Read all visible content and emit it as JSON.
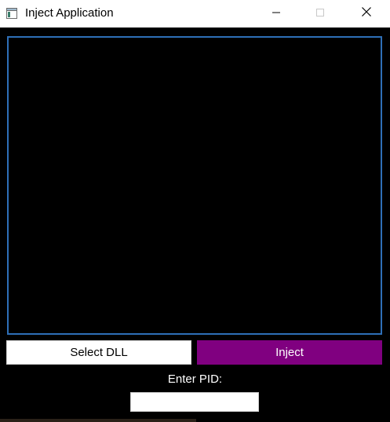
{
  "window": {
    "title": "Inject Application",
    "icon": "app-window-icon",
    "controls": {
      "minimize_icon": "minimize-icon",
      "maximize_icon": "maximize-icon",
      "close_icon": "close-icon"
    }
  },
  "main": {
    "output_panel_border_color": "#2e6fb7",
    "buttons": {
      "select_dll_label": "Select DLL",
      "inject_label": "Inject",
      "inject_color": "#800080"
    },
    "pid": {
      "label": "Enter PID:",
      "value": "",
      "placeholder": ""
    }
  }
}
